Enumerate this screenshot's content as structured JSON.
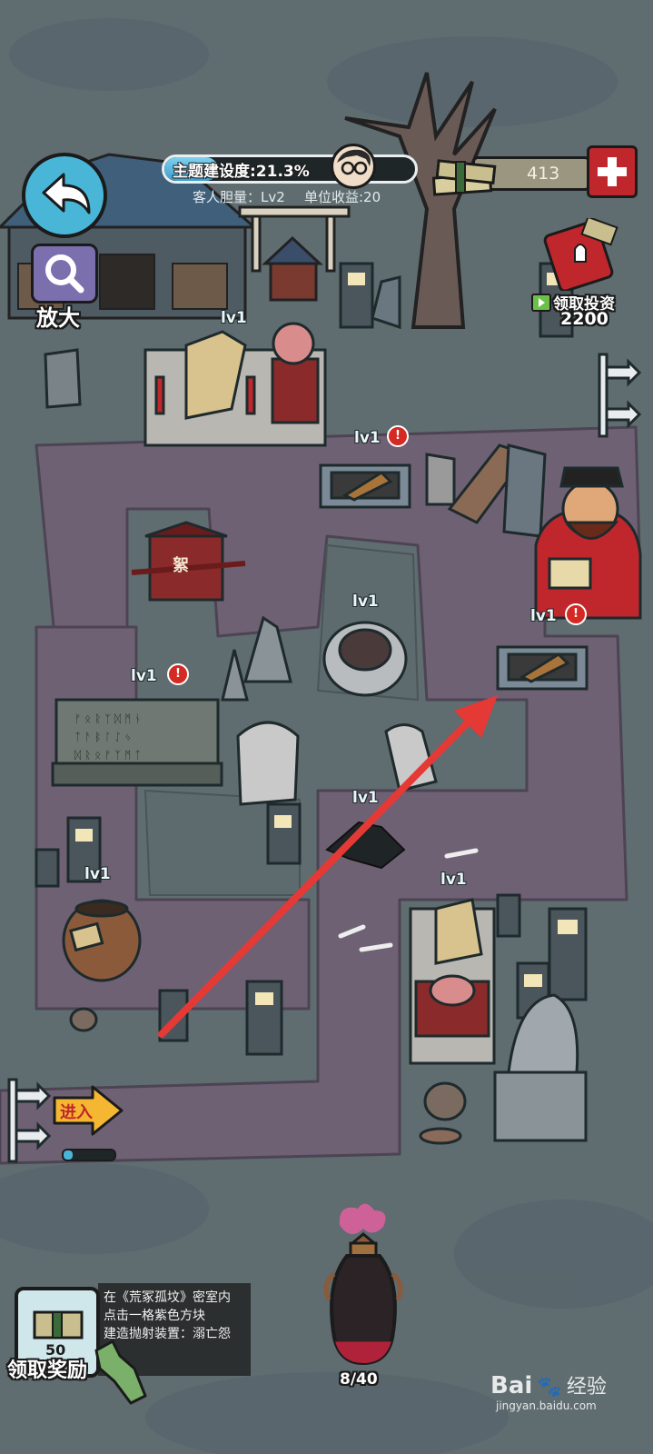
{
  "hud": {
    "progress_label": "主题建设度:21.3%",
    "progress_fraction": 0.213,
    "courage_text": "客人胆量：Lv2",
    "unit_income_text": "单位收益:20",
    "money_value": "413",
    "zoom_label": "放大",
    "invest_label": "领取投资",
    "invest_amount": "2200",
    "enter_label": "进入"
  },
  "levels": {
    "altar_top": "lv1",
    "fire_pit_1": "lv1",
    "fire_pit_2": "lv1",
    "well": "lv1",
    "stone_tablet": "lv1",
    "crack": "lv1",
    "urn": "lv1",
    "altar_bottom": "lv1"
  },
  "alerts": {
    "mark": "!"
  },
  "tablet_text": "絮",
  "task": {
    "line1": "在《荒冢孤坟》密室内",
    "line2": "点击一格紫色方块",
    "line3": "建造抛射装置：溺亡怨",
    "reward_value": "50",
    "claim_label": "领取奖励"
  },
  "jar": {
    "count_text": "8/40",
    "fill_fraction": 0.2
  },
  "watermark": {
    "brand": "Bai",
    "cn": "经验",
    "url": "jingyan.baidu.com"
  },
  "colors": {
    "ground": "#5d6a6e",
    "path": "#6f6273",
    "progress_fill": "#3a9fd0",
    "money_button": "#c0272d",
    "arrow": "#e53935"
  },
  "icons": {
    "back": "back-arrow-icon",
    "zoom": "magnifier-icon",
    "money": "cash-stack-icon",
    "plus": "plus-icon",
    "ad": "play-icon"
  }
}
